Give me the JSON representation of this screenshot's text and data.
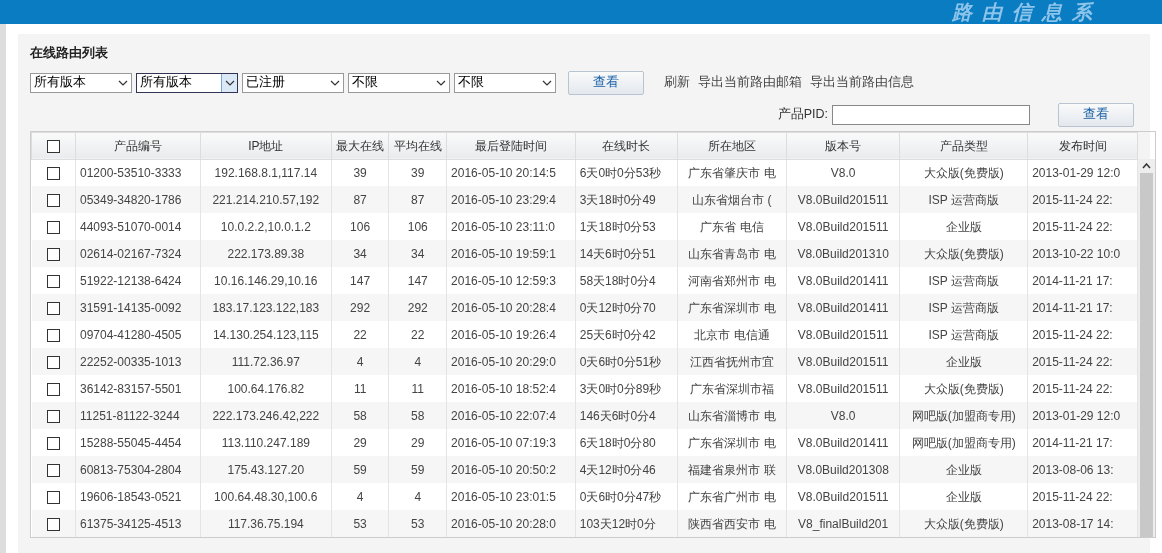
{
  "banner": {
    "title": "路由信息系"
  },
  "panel": {
    "title": "在线路由列表"
  },
  "filters": [
    {
      "value": "所有版本",
      "focused": false
    },
    {
      "value": "所有版本",
      "focused": true
    },
    {
      "value": "已注册",
      "focused": false
    },
    {
      "value": "不限",
      "focused": false
    },
    {
      "value": "不限",
      "focused": false
    }
  ],
  "filter_button": "查看",
  "links": [
    "刷新",
    "导出当前路由邮箱",
    "导出当前路由信息"
  ],
  "pid": {
    "label": "产品PID:",
    "button": "查看"
  },
  "table": {
    "select_all": {
      "checked": false
    },
    "columns": [
      "产品编号",
      "IP地址",
      "最大在线",
      "平均在线",
      "最后登陆时间",
      "在线时长",
      "所在地区",
      "版本号",
      "产品类型",
      "发布时间"
    ],
    "rows": [
      {
        "checked": false,
        "cells": [
          "01200-53510-3333",
          "192.168.8.1,117.14",
          "39",
          "39",
          "2016-05-10 20:14:5",
          "6天0时0分53秒",
          "广东省肇庆市 电",
          "V8.0",
          "大众版(免费版)",
          "2013-01-29 12:0"
        ]
      },
      {
        "checked": false,
        "cells": [
          "05349-34820-1786",
          "221.214.210.57,192",
          "87",
          "87",
          "2016-05-10 23:29:4",
          "3天18时0分49",
          "山东省烟台市 (",
          "V8.0Build201511",
          "ISP 运营商版",
          "2015-11-24 22:"
        ]
      },
      {
        "checked": false,
        "cells": [
          "44093-51070-0014",
          "10.0.2.2,10.0.1.2",
          "106",
          "106",
          "2016-05-10 23:11:0",
          "1天18时0分53",
          "广东省 电信",
          "V8.0Build201511",
          "企业版",
          "2015-11-24 22:"
        ]
      },
      {
        "checked": false,
        "cells": [
          "02614-02167-7324",
          "222.173.89.38",
          "34",
          "34",
          "2016-05-10 19:59:1",
          "14天6时0分51",
          "山东省青岛市 电",
          "V8.0Build201310",
          "大众版(免费版)",
          "2013-10-22 10:0"
        ]
      },
      {
        "checked": false,
        "cells": [
          "51922-12138-6424",
          "10.16.146.29,10.16",
          "147",
          "147",
          "2016-05-10 12:59:3",
          "58天18时0分4",
          "河南省郑州市 电",
          "V8.0Build201411",
          "ISP 运营商版",
          "2014-11-21 17:"
        ]
      },
      {
        "checked": false,
        "cells": [
          "31591-14135-0092",
          "183.17.123.122,183",
          "292",
          "292",
          "2016-05-10 20:28:4",
          "0天12时0分70",
          "广东省深圳市 电",
          "V8.0Build201411",
          "ISP 运营商版",
          "2014-11-21 17:"
        ]
      },
      {
        "checked": false,
        "cells": [
          "09704-41280-4505",
          "14.130.254.123,115",
          "22",
          "22",
          "2016-05-10 19:26:4",
          "25天6时0分42",
          "北京市 电信通",
          "V8.0Build201511",
          "ISP 运营商版",
          "2015-11-24 22:"
        ]
      },
      {
        "checked": false,
        "cells": [
          "22252-00335-1013",
          "111.72.36.97",
          "4",
          "4",
          "2016-05-10 20:29:0",
          "0天6时0分51秒",
          "江西省抚州市宜",
          "V8.0Build201511",
          "企业版",
          "2015-11-24 22:"
        ]
      },
      {
        "checked": false,
        "cells": [
          "36142-83157-5501",
          "100.64.176.82",
          "11",
          "11",
          "2016-05-10 18:52:4",
          "3天0时0分89秒",
          "广东省深圳市福",
          "V8.0Build201511",
          "大众版(免费版)",
          "2015-11-24 22:"
        ]
      },
      {
        "checked": false,
        "cells": [
          "11251-81122-3244",
          "222.173.246.42,222",
          "58",
          "58",
          "2016-05-10 22:07:4",
          "146天6时0分4",
          "山东省淄博市 电",
          "V8.0",
          "网吧版(加盟商专用)",
          "2013-01-29 12:0"
        ]
      },
      {
        "checked": false,
        "cells": [
          "15288-55045-4454",
          "113.110.247.189",
          "29",
          "29",
          "2016-05-10 07:19:3",
          "6天18时0分80",
          "广东省深圳市 电",
          "V8.0Build201411",
          "网吧版(加盟商专用)",
          "2014-11-21 17:"
        ]
      },
      {
        "checked": false,
        "cells": [
          "60813-75304-2804",
          "175.43.127.20",
          "59",
          "59",
          "2016-05-10 20:50:2",
          "4天12时0分46",
          "福建省泉州市 联",
          "V8.0Build201308",
          "企业版",
          "2013-08-06 13:"
        ]
      },
      {
        "checked": false,
        "cells": [
          "19606-18543-0521",
          "100.64.48.30,100.6",
          "4",
          "4",
          "2016-05-10 23:01:5",
          "0天6时0分47秒",
          "广东省广州市 电",
          "V8.0Build201511",
          "企业版",
          "2015-11-24 22:"
        ]
      },
      {
        "checked": false,
        "cells": [
          "61375-34125-4513",
          "117.36.75.194",
          "53",
          "53",
          "2016-05-10 20:28:0",
          "103天12时0分",
          "陕西省西安市 电",
          "V8_finalBuild201",
          "大众版(免费版)",
          "2013-08-17 14:"
        ]
      }
    ]
  }
}
